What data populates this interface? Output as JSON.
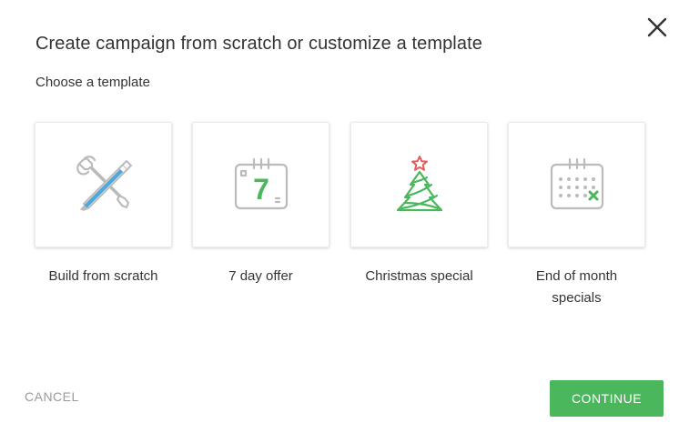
{
  "dialog": {
    "title": "Create campaign from scratch or customize a template",
    "subtitle": "Choose a template"
  },
  "templates": [
    {
      "label": "Build from scratch",
      "icon": "tools-icon"
    },
    {
      "label": "7 day offer",
      "icon": "calendar-seven-icon",
      "icon_text": "7"
    },
    {
      "label": "Christmas special",
      "icon": "christmas-tree-icon"
    },
    {
      "label": "End of month specials",
      "icon": "calendar-month-end-icon"
    }
  ],
  "actions": {
    "cancel_label": "CANCEL",
    "continue_label": "CONTINUE"
  },
  "colors": {
    "accent": "#4bb75c",
    "icon_gray": "#bbbbbb",
    "icon_blue": "#4aa3dd",
    "icon_green": "#4bb75c",
    "icon_red": "#e65a5a",
    "cancel_text": "#9a9a9a"
  }
}
